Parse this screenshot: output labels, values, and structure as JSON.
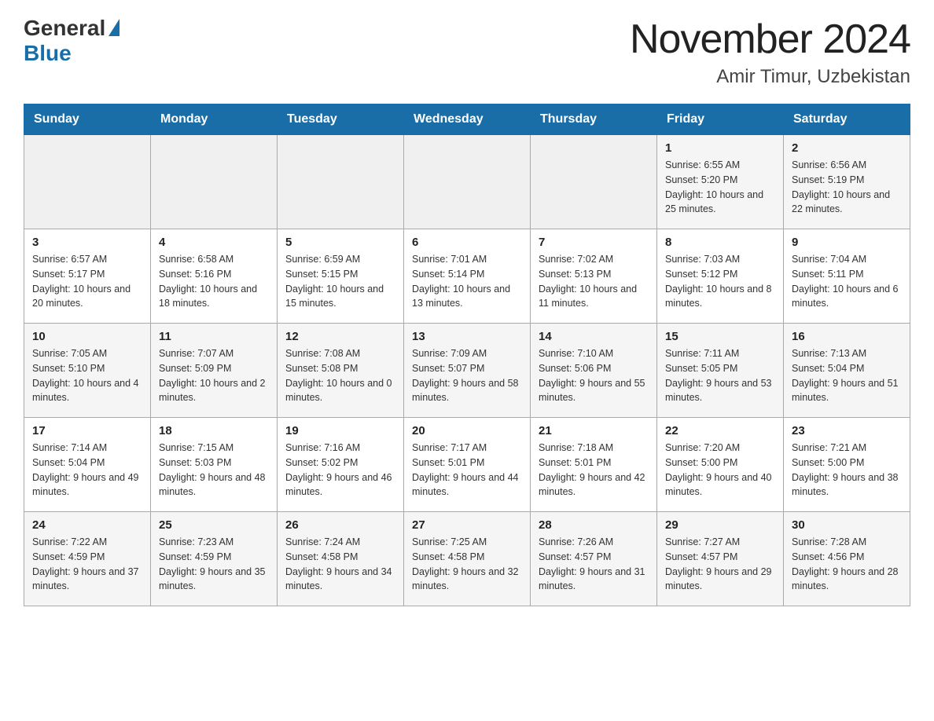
{
  "header": {
    "logo_general": "General",
    "logo_blue": "Blue",
    "month_title": "November 2024",
    "location": "Amir Timur, Uzbekistan"
  },
  "weekdays": [
    "Sunday",
    "Monday",
    "Tuesday",
    "Wednesday",
    "Thursday",
    "Friday",
    "Saturday"
  ],
  "weeks": [
    [
      {
        "day": "",
        "sunrise": "",
        "sunset": "",
        "daylight": ""
      },
      {
        "day": "",
        "sunrise": "",
        "sunset": "",
        "daylight": ""
      },
      {
        "day": "",
        "sunrise": "",
        "sunset": "",
        "daylight": ""
      },
      {
        "day": "",
        "sunrise": "",
        "sunset": "",
        "daylight": ""
      },
      {
        "day": "",
        "sunrise": "",
        "sunset": "",
        "daylight": ""
      },
      {
        "day": "1",
        "sunrise": "Sunrise: 6:55 AM",
        "sunset": "Sunset: 5:20 PM",
        "daylight": "Daylight: 10 hours and 25 minutes."
      },
      {
        "day": "2",
        "sunrise": "Sunrise: 6:56 AM",
        "sunset": "Sunset: 5:19 PM",
        "daylight": "Daylight: 10 hours and 22 minutes."
      }
    ],
    [
      {
        "day": "3",
        "sunrise": "Sunrise: 6:57 AM",
        "sunset": "Sunset: 5:17 PM",
        "daylight": "Daylight: 10 hours and 20 minutes."
      },
      {
        "day": "4",
        "sunrise": "Sunrise: 6:58 AM",
        "sunset": "Sunset: 5:16 PM",
        "daylight": "Daylight: 10 hours and 18 minutes."
      },
      {
        "day": "5",
        "sunrise": "Sunrise: 6:59 AM",
        "sunset": "Sunset: 5:15 PM",
        "daylight": "Daylight: 10 hours and 15 minutes."
      },
      {
        "day": "6",
        "sunrise": "Sunrise: 7:01 AM",
        "sunset": "Sunset: 5:14 PM",
        "daylight": "Daylight: 10 hours and 13 minutes."
      },
      {
        "day": "7",
        "sunrise": "Sunrise: 7:02 AM",
        "sunset": "Sunset: 5:13 PM",
        "daylight": "Daylight: 10 hours and 11 minutes."
      },
      {
        "day": "8",
        "sunrise": "Sunrise: 7:03 AM",
        "sunset": "Sunset: 5:12 PM",
        "daylight": "Daylight: 10 hours and 8 minutes."
      },
      {
        "day": "9",
        "sunrise": "Sunrise: 7:04 AM",
        "sunset": "Sunset: 5:11 PM",
        "daylight": "Daylight: 10 hours and 6 minutes."
      }
    ],
    [
      {
        "day": "10",
        "sunrise": "Sunrise: 7:05 AM",
        "sunset": "Sunset: 5:10 PM",
        "daylight": "Daylight: 10 hours and 4 minutes."
      },
      {
        "day": "11",
        "sunrise": "Sunrise: 7:07 AM",
        "sunset": "Sunset: 5:09 PM",
        "daylight": "Daylight: 10 hours and 2 minutes."
      },
      {
        "day": "12",
        "sunrise": "Sunrise: 7:08 AM",
        "sunset": "Sunset: 5:08 PM",
        "daylight": "Daylight: 10 hours and 0 minutes."
      },
      {
        "day": "13",
        "sunrise": "Sunrise: 7:09 AM",
        "sunset": "Sunset: 5:07 PM",
        "daylight": "Daylight: 9 hours and 58 minutes."
      },
      {
        "day": "14",
        "sunrise": "Sunrise: 7:10 AM",
        "sunset": "Sunset: 5:06 PM",
        "daylight": "Daylight: 9 hours and 55 minutes."
      },
      {
        "day": "15",
        "sunrise": "Sunrise: 7:11 AM",
        "sunset": "Sunset: 5:05 PM",
        "daylight": "Daylight: 9 hours and 53 minutes."
      },
      {
        "day": "16",
        "sunrise": "Sunrise: 7:13 AM",
        "sunset": "Sunset: 5:04 PM",
        "daylight": "Daylight: 9 hours and 51 minutes."
      }
    ],
    [
      {
        "day": "17",
        "sunrise": "Sunrise: 7:14 AM",
        "sunset": "Sunset: 5:04 PM",
        "daylight": "Daylight: 9 hours and 49 minutes."
      },
      {
        "day": "18",
        "sunrise": "Sunrise: 7:15 AM",
        "sunset": "Sunset: 5:03 PM",
        "daylight": "Daylight: 9 hours and 48 minutes."
      },
      {
        "day": "19",
        "sunrise": "Sunrise: 7:16 AM",
        "sunset": "Sunset: 5:02 PM",
        "daylight": "Daylight: 9 hours and 46 minutes."
      },
      {
        "day": "20",
        "sunrise": "Sunrise: 7:17 AM",
        "sunset": "Sunset: 5:01 PM",
        "daylight": "Daylight: 9 hours and 44 minutes."
      },
      {
        "day": "21",
        "sunrise": "Sunrise: 7:18 AM",
        "sunset": "Sunset: 5:01 PM",
        "daylight": "Daylight: 9 hours and 42 minutes."
      },
      {
        "day": "22",
        "sunrise": "Sunrise: 7:20 AM",
        "sunset": "Sunset: 5:00 PM",
        "daylight": "Daylight: 9 hours and 40 minutes."
      },
      {
        "day": "23",
        "sunrise": "Sunrise: 7:21 AM",
        "sunset": "Sunset: 5:00 PM",
        "daylight": "Daylight: 9 hours and 38 minutes."
      }
    ],
    [
      {
        "day": "24",
        "sunrise": "Sunrise: 7:22 AM",
        "sunset": "Sunset: 4:59 PM",
        "daylight": "Daylight: 9 hours and 37 minutes."
      },
      {
        "day": "25",
        "sunrise": "Sunrise: 7:23 AM",
        "sunset": "Sunset: 4:59 PM",
        "daylight": "Daylight: 9 hours and 35 minutes."
      },
      {
        "day": "26",
        "sunrise": "Sunrise: 7:24 AM",
        "sunset": "Sunset: 4:58 PM",
        "daylight": "Daylight: 9 hours and 34 minutes."
      },
      {
        "day": "27",
        "sunrise": "Sunrise: 7:25 AM",
        "sunset": "Sunset: 4:58 PM",
        "daylight": "Daylight: 9 hours and 32 minutes."
      },
      {
        "day": "28",
        "sunrise": "Sunrise: 7:26 AM",
        "sunset": "Sunset: 4:57 PM",
        "daylight": "Daylight: 9 hours and 31 minutes."
      },
      {
        "day": "29",
        "sunrise": "Sunrise: 7:27 AM",
        "sunset": "Sunset: 4:57 PM",
        "daylight": "Daylight: 9 hours and 29 minutes."
      },
      {
        "day": "30",
        "sunrise": "Sunrise: 7:28 AM",
        "sunset": "Sunset: 4:56 PM",
        "daylight": "Daylight: 9 hours and 28 minutes."
      }
    ]
  ]
}
